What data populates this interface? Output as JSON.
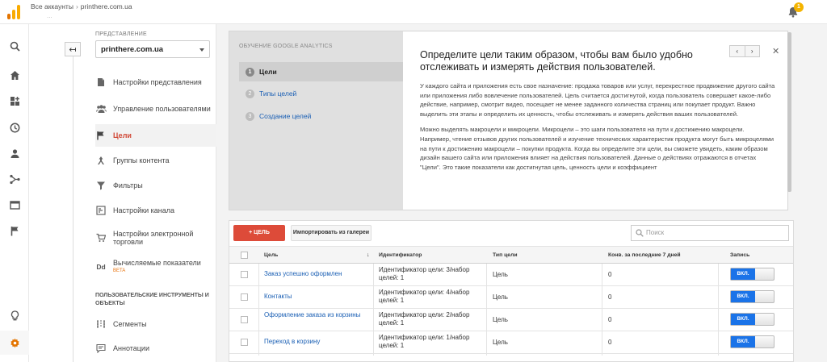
{
  "topbar": {
    "breadcrumb_root": "Все аккаунты",
    "breadcrumb_account": "printhere.com.ua",
    "breadcrumb_sub": "...",
    "notification_count": "1"
  },
  "nav": {
    "view_label": "ПРЕДСТАВЛЕНИЕ",
    "view_value": "printhere.com.ua",
    "items": [
      {
        "label": "Настройки представления"
      },
      {
        "label": "Управление пользователями"
      },
      {
        "label": "Цели"
      },
      {
        "label": "Группы контента"
      },
      {
        "label": "Фильтры"
      },
      {
        "label": "Настройки канала"
      },
      {
        "label": "Настройки электронной торговли"
      },
      {
        "label": "Вычисляемые показатели",
        "badge": "BETA"
      }
    ],
    "section_title": "ПОЛЬЗОВАТЕЛЬСКИЕ ИНСТРУМЕНТЫ И ОБЪЕКТЫ",
    "section_items": [
      {
        "label": "Сегменты"
      },
      {
        "label": "Аннотации"
      }
    ]
  },
  "learn": {
    "title": "ОБУЧЕНИЕ GOOGLE ANALYTICS",
    "steps": [
      {
        "num": "1",
        "label": "Цели"
      },
      {
        "num": "2",
        "label": "Типы целей"
      },
      {
        "num": "3",
        "label": "Создание целей"
      }
    ],
    "heading": "Определите цели таким образом, чтобы вам было удобно отслеживать и измерять действия пользователей.",
    "prev": "‹",
    "next": "›",
    "close": "✕",
    "paragraph1": "У каждого сайта и приложения есть свое назначение: продажа товаров или услуг, перекрестное продвижение другого сайта или приложения либо вовлечение пользователей. Цель считается достигнутой, когда пользователь совершает какое-либо действие, например, смотрит видео, посещает не менее заданного количества страниц или покупает продукт. Важно выделить эти этапы и определить их ценность, чтобы отслеживать и измерять действия ваших пользователей.",
    "paragraph2": "Можно выделять макроцели и микроцели. Микроцели – это шаги пользователя на пути к достижению макроцели. Например, чтение отзывов других пользователей и изучение технических характеристик продукта могут быть микроцелями на пути к достижению макроцели – покупки продукта. Когда вы определите эти цели, вы сможете увидеть, каким образом дизайн вашего сайта или приложения влияет на действия пользователей. Данные о действиях отражаются в отчетах \"Цели\". Это такие показатели как достигнутая цель, ценность цели и коэффициент"
  },
  "goals": {
    "add_button": "+ ЦЕЛЬ",
    "import_button": "Импортировать из галереи",
    "search_placeholder": "Поиск",
    "columns": {
      "name": "Цель",
      "id": "Идентификатор",
      "type": "Тип цели",
      "conv": "Конв. за последние 7 дней",
      "record": "Запись"
    },
    "rows": [
      {
        "name": "Заказ успешно оформлен",
        "id": "Идентификатор цели: 3/набор целей: 1",
        "type": "Цель",
        "conv": "0",
        "toggle": "ВКЛ."
      },
      {
        "name": "Контакты",
        "id": "Идентификатор цели: 4/набор целей: 1",
        "type": "Цель",
        "conv": "0",
        "toggle": "ВКЛ."
      },
      {
        "name": "Оформление заказа из корзины",
        "id": "Идентификатор цели: 2/набор целей: 1",
        "type": "Цель",
        "conv": "0",
        "toggle": "ВКЛ."
      },
      {
        "name": "Переход в корзину",
        "id": "Идентификатор цели: 1/набор целей: 1",
        "type": "Цель",
        "conv": "0",
        "toggle": "ВКЛ."
      }
    ]
  },
  "colors": {
    "accent": "#d14836",
    "link": "#1a5fb4",
    "toggle_on": "#1a73e8",
    "add": "#dd4b39"
  }
}
